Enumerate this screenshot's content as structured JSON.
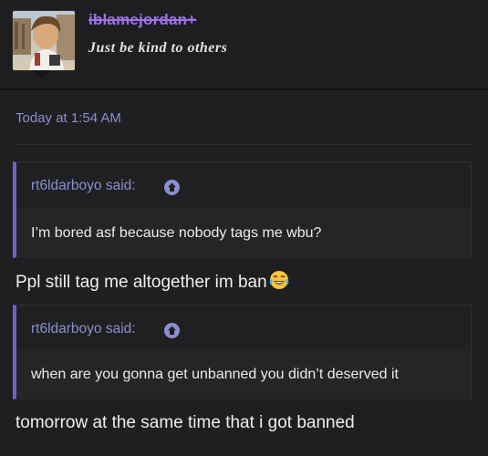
{
  "post": {
    "author": {
      "username": "iblamejordan+",
      "title": "Just be kind to others",
      "avatar_icon": "avatar-photo"
    },
    "timestamp": "Today at 1:54 AM"
  },
  "thread": {
    "quote_1": {
      "author": "rt6ldarboyo said:",
      "text": "I’m bored asf because nobody tags me wbu?",
      "icon": "arrow-up-icon"
    },
    "reply_1": {
      "text": "Ppl still tag me altogether im ban",
      "emoji": "tears-of-joy-emoji"
    },
    "quote_2": {
      "author": "rt6ldarboyo said:",
      "text": "when are you gonna get unbanned you didn’t deserved it",
      "icon": "arrow-up-icon"
    },
    "reply_2": {
      "text": "tomorrow at the same time that i got banned"
    }
  },
  "colors": {
    "background": "#1f1f21",
    "accent": "#8a8fd0",
    "quote_bar": "#6d63c9",
    "username": "#9b72e8"
  }
}
